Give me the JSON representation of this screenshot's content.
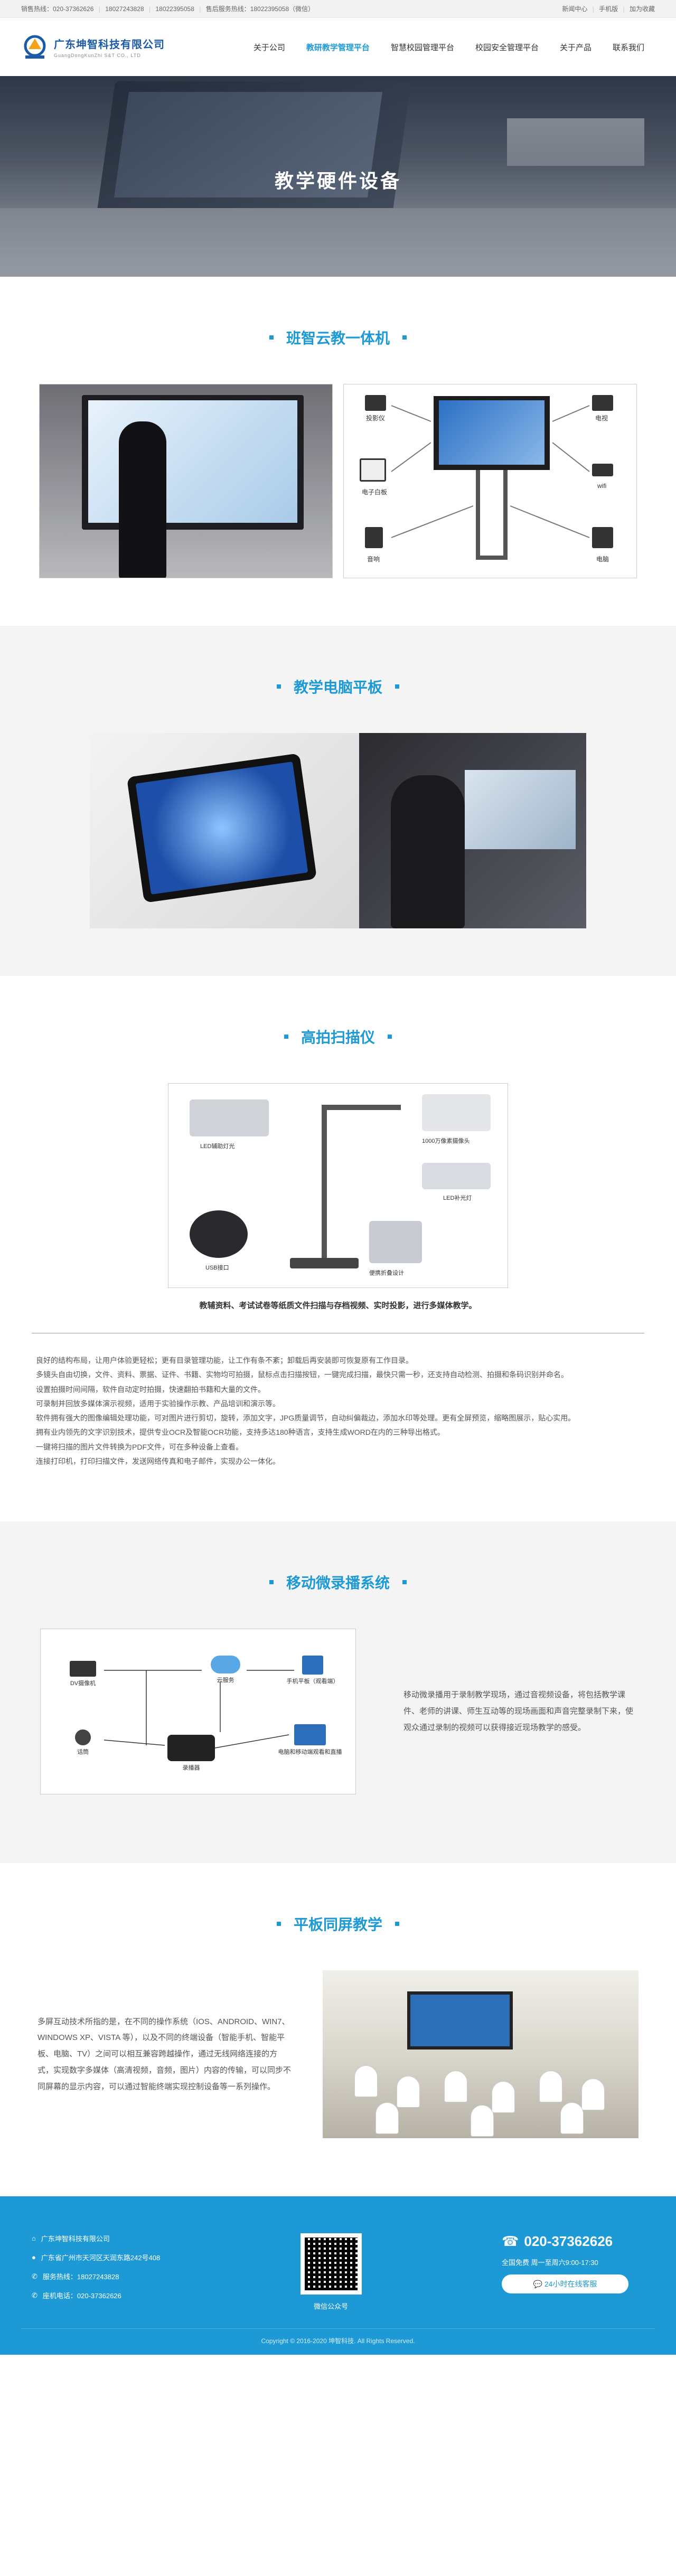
{
  "topbar": {
    "sales_hotline": "销售热线：020-37362626",
    "phone_1": "18027243828",
    "phone_2": "18022395058",
    "service_hotline": "售后服务热线：18022395058（微信）",
    "links": [
      "新闻中心",
      "手机版",
      "加为收藏"
    ]
  },
  "header": {
    "company_name": "广东坤智科技有限公司",
    "company_en": "GuangDongKunZhi S&T CO., LTD"
  },
  "nav": {
    "items": [
      "关于公司",
      "教研教学管理平台",
      "智慧校园管理平台",
      "校园安全管理平台",
      "关于产品",
      "联系我们"
    ],
    "active_index": 1
  },
  "hero": {
    "title": "教学硬件设备"
  },
  "section1": {
    "title": "班智云教一体机",
    "devices": [
      "投影仪",
      "电视",
      "电子白板",
      "wifi",
      "音响",
      "电脑"
    ]
  },
  "section2": {
    "title": "教学电脑平板"
  },
  "section3": {
    "title": "高拍扫描仪",
    "image_labels": [
      "LED辅助灯光",
      "1000万像素摄像头",
      "LED补光灯",
      "USB接口",
      "便携折叠设计"
    ],
    "caption": "教辅资料、考试试卷等纸质文件扫描与存档视频、实时投影，进行多媒体教学。",
    "paragraphs": [
      "良好的结构布局，让用户体验更轻松；更有目录管理功能，让工作有条不紊；卸载后再安装即可恢复原有工作目录。",
      "多镜头自由切换，文件、资料、票据、证件、书籍、实物均可拍摄，鼠标点击扫描按钮，一键完成扫描，最快只需一秒，还支持自动检测、拍摄和条码识别并命名。",
      "设置拍摄时间间隔，软件自动定时拍摄，快速翻拍书籍和大量的文件。",
      "可录制并回放多媒体演示视频，适用于实验操作示教、产品培训和演示等。",
      "软件拥有强大的图像编辑处理功能，可对图片进行剪切，旋转，添加文字，JPG质量调节，自动纠偏裁边，添加水印等处理。更有全屏预览，缩略图展示，贴心实用。",
      "拥有业内领先的文字识别技术，提供专业OCR及智能OCR功能，支持多达180种语言，支持生成WORD在内的三种导出格式。",
      "一键将扫描的图片文件转换为PDF文件，可在多种设备上查看。",
      "连接打印机，打印扫描文件，发送网络传真和电子邮件，实现办公一体化。"
    ]
  },
  "section4": {
    "title": "移动微录播系统",
    "nodes": [
      "DV摄像机",
      "云服务",
      "手机平板（观看端）",
      "话筒",
      "录播器",
      "电脑和移动端观看和直播"
    ],
    "description": "移动微录播用于录制教学现场，通过音视频设备，将包括教学课件、老师的讲课、师生互动等的现场画面和声音完整录制下来，使观众通过录制的视频可以获得接近现场教学的感受。"
  },
  "section5": {
    "title": "平板同屏教学",
    "description": "多屏互动技术所指的是，在不同的操作系统（IOS、ANDROID、WIN7、WINDOWS XP、VISTA 等），以及不同的终端设备（智能手机、智能平板、电脑、TV）之间可以相互兼容跨越操作，通过无线网络连接的方式，实现数字多媒体（高清视频，音频，图片）内容的传输，可以同步不同屏幕的显示内容，可以通过智能终端实现控制设备等一系列操作。"
  },
  "footer": {
    "company": "广东坤智科技有限公司",
    "address": "广东省广州市天河区天润东路242号408",
    "hotline": "服务热线：18027243828",
    "tel": "座机电话：020-37362626",
    "qr_caption": "微信公众号",
    "phone": "020-37362626",
    "hours": "全国免费 周一至周六9:00-17:30",
    "online_button": "24小时在线客服",
    "copyright": "Copyright © 2016-2020 坤智科技. All Rights Reserved."
  },
  "colors": {
    "accent": "#1d9ad6",
    "logo_blue": "#1a5aa6",
    "section_gray": "#f4f4f4"
  }
}
